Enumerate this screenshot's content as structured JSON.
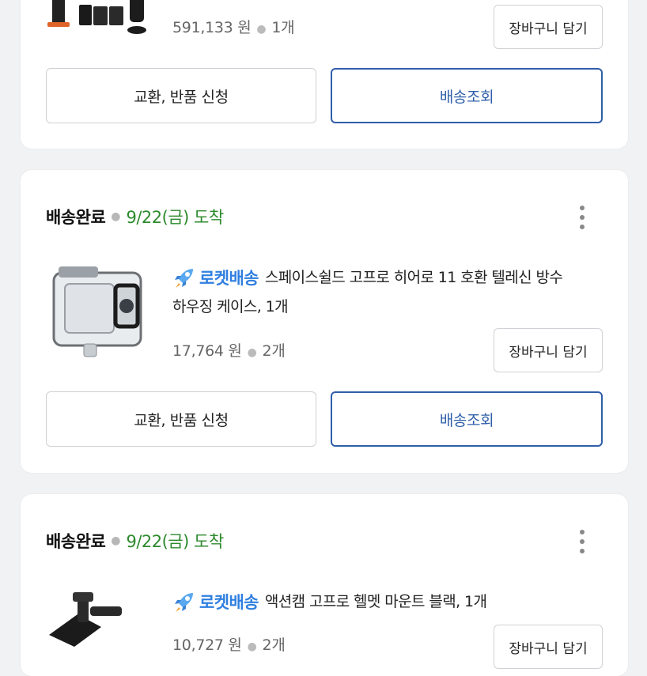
{
  "orders": [
    {
      "price": "591,133 원",
      "qty": "1개",
      "cart_label": "장바구니 담기",
      "return_label": "교환, 반품 신청",
      "track_label": "배송조회"
    },
    {
      "status": "배송완료",
      "arrival": "9/22(금) 도착",
      "badge": "로켓배송",
      "title_line1": "스페이스쉴드 고프로 히어로 11 호환 텔레신 방수",
      "title_line2": "하우징 케이스, 1개",
      "price": "17,764 원",
      "qty": "2개",
      "cart_label": "장바구니 담기",
      "return_label": "교환, 반품 신청",
      "track_label": "배송조회"
    },
    {
      "status": "배송완료",
      "arrival": "9/22(금) 도착",
      "badge": "로켓배송",
      "title_line1": "액션캠 고프로 헬멧 마운트 블랙, 1개",
      "price": "10,727 원",
      "qty": "2개",
      "cart_label": "장바구니 담기"
    }
  ],
  "colors": {
    "rocket_blue": "#2f7fe0",
    "arrival_green": "#2d8a2d",
    "primary_border": "#2f5fa8"
  },
  "icons": [
    "rocket-icon",
    "more-vertical-icon"
  ]
}
